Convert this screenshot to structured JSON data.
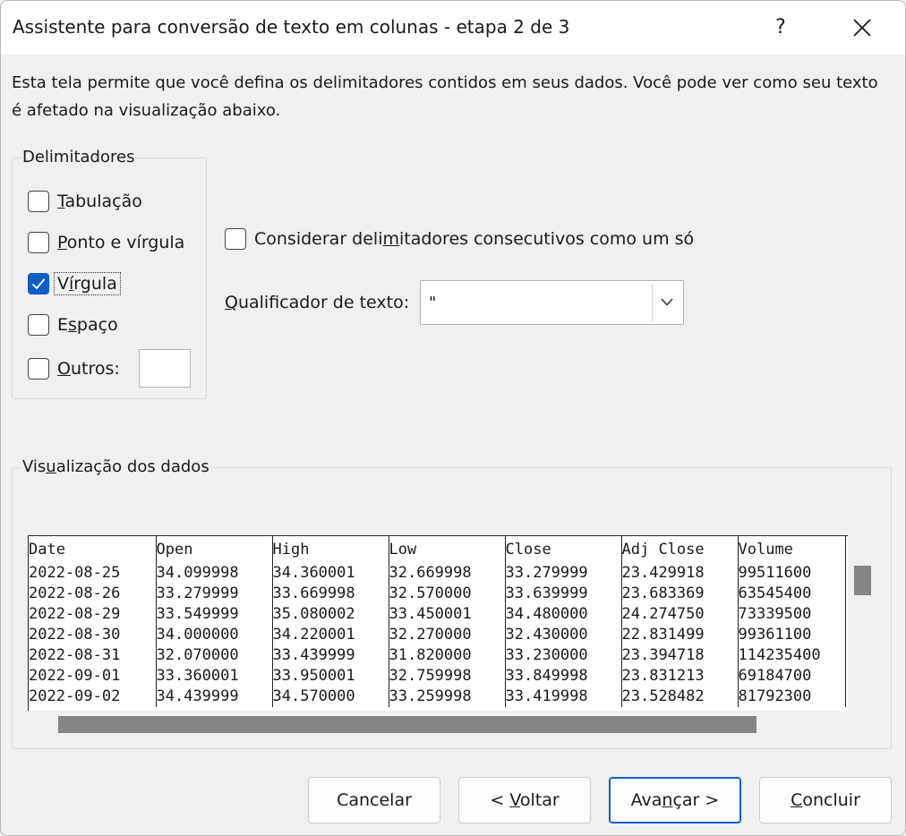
{
  "window": {
    "title": "Assistente para conversão de texto em colunas - etapa 2 de 3",
    "help_label": "?"
  },
  "description": "Esta tela permite que você defina os delimitadores contidos em seus dados. Você pode ver como seu texto é afetado na visualização abaixo.",
  "delimiters": {
    "legend": "Delimitadores",
    "tab": {
      "prefix": "",
      "key": "T",
      "suffix": "abulação",
      "checked": false
    },
    "semicolon": {
      "prefix": "",
      "key": "P",
      "suffix": "onto e vírgula",
      "checked": false
    },
    "comma": {
      "prefix": "V",
      "key": "í",
      "suffix": "rgula",
      "checked": true
    },
    "space": {
      "prefix": "E",
      "key": "s",
      "suffix": "paço",
      "checked": false
    },
    "other": {
      "prefix": "",
      "key": "O",
      "suffix": "utros:",
      "checked": false,
      "value": ""
    }
  },
  "consecutive": {
    "prefix": "Considerar deli",
    "key": "m",
    "suffix": "itadores consecutivos como um só",
    "checked": false
  },
  "qualifier": {
    "prefix": "",
    "key": "Q",
    "suffix": "ualificador de texto:",
    "value": "\""
  },
  "preview": {
    "legend_prefix": "Vis",
    "legend_key": "u",
    "legend_suffix": "alização dos dados",
    "columns": [
      "Date",
      "Open",
      "High",
      "Low",
      "Close",
      "Adj Close",
      "Volume"
    ],
    "rows": [
      [
        "2022-08-25",
        "34.099998",
        "34.360001",
        "32.669998",
        "33.279999",
        "23.429918",
        "99511600"
      ],
      [
        "2022-08-26",
        "33.279999",
        "33.669998",
        "32.570000",
        "33.639999",
        "23.683369",
        "63545400"
      ],
      [
        "2022-08-29",
        "33.549999",
        "35.080002",
        "33.450001",
        "34.480000",
        "24.274750",
        "73339500"
      ],
      [
        "2022-08-30",
        "34.000000",
        "34.220001",
        "32.270000",
        "32.430000",
        "22.831499",
        "99361100"
      ],
      [
        "2022-08-31",
        "32.070000",
        "33.439999",
        "31.820000",
        "33.230000",
        "23.394718",
        "114235400"
      ],
      [
        "2022-09-01",
        "33.360001",
        "33.950001",
        "32.759998",
        "33.849998",
        "23.831213",
        "69184700"
      ],
      [
        "2022-09-02",
        "34.439999",
        "34.570000",
        "33.259998",
        "33.419998",
        "23.528482",
        "81792300"
      ]
    ]
  },
  "buttons": {
    "cancel": "Cancelar",
    "back_prefix": "< ",
    "back_key": "V",
    "back_suffix": "oltar",
    "next_prefix": "Ava",
    "next_key": "n",
    "next_suffix": "çar >",
    "finish_prefix": "",
    "finish_key": "C",
    "finish_suffix": "oncluir"
  },
  "colors": {
    "accent": "#0f5ec8",
    "scrollbar": "#858585"
  }
}
